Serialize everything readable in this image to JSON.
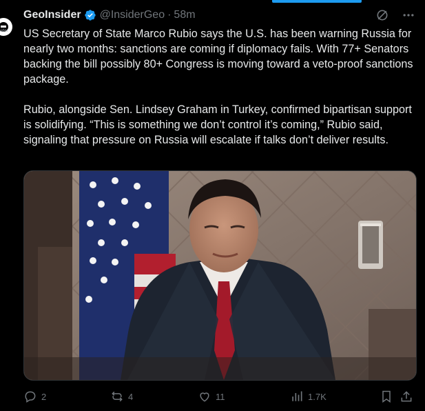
{
  "tweet": {
    "author_name": "GeoInsider",
    "author_handle": "@InsiderGeo",
    "separator": "·",
    "time": "58m",
    "avatar_caption": "insider",
    "paragraphs": [
      "US Secretary of State Marco Rubio says the U.S. has been warning Russia for nearly two months: sanctions are coming if diplomacy fails. With 77+ Senators backing the bill possibly 80+ Congress is moving toward a veto-proof sanctions package.",
      "Rubio, alongside Sen. Lindsey Graham in Turkey, confirmed bipartisan support is solidifying. “This is something we don’t control it’s coming,” Rubio said, signaling that pressure on Russia will escalate if talks don’t deliver results."
    ]
  },
  "media": {
    "type": "photo",
    "alt": ""
  },
  "actions": {
    "replies": "2",
    "reposts": "4",
    "likes": "11",
    "views": "1.7K"
  },
  "icons": {
    "verified": "verified-badge-icon",
    "grok": "grok-icon",
    "more": "more-icon",
    "reply": "reply-icon",
    "repost": "repost-icon",
    "like": "like-icon",
    "views": "views-icon",
    "bookmark": "bookmark-icon",
    "share": "share-icon"
  },
  "colors": {
    "accent": "#1d9bf0",
    "background": "#000000",
    "text": "#e7e9ea",
    "muted": "#71767b"
  }
}
